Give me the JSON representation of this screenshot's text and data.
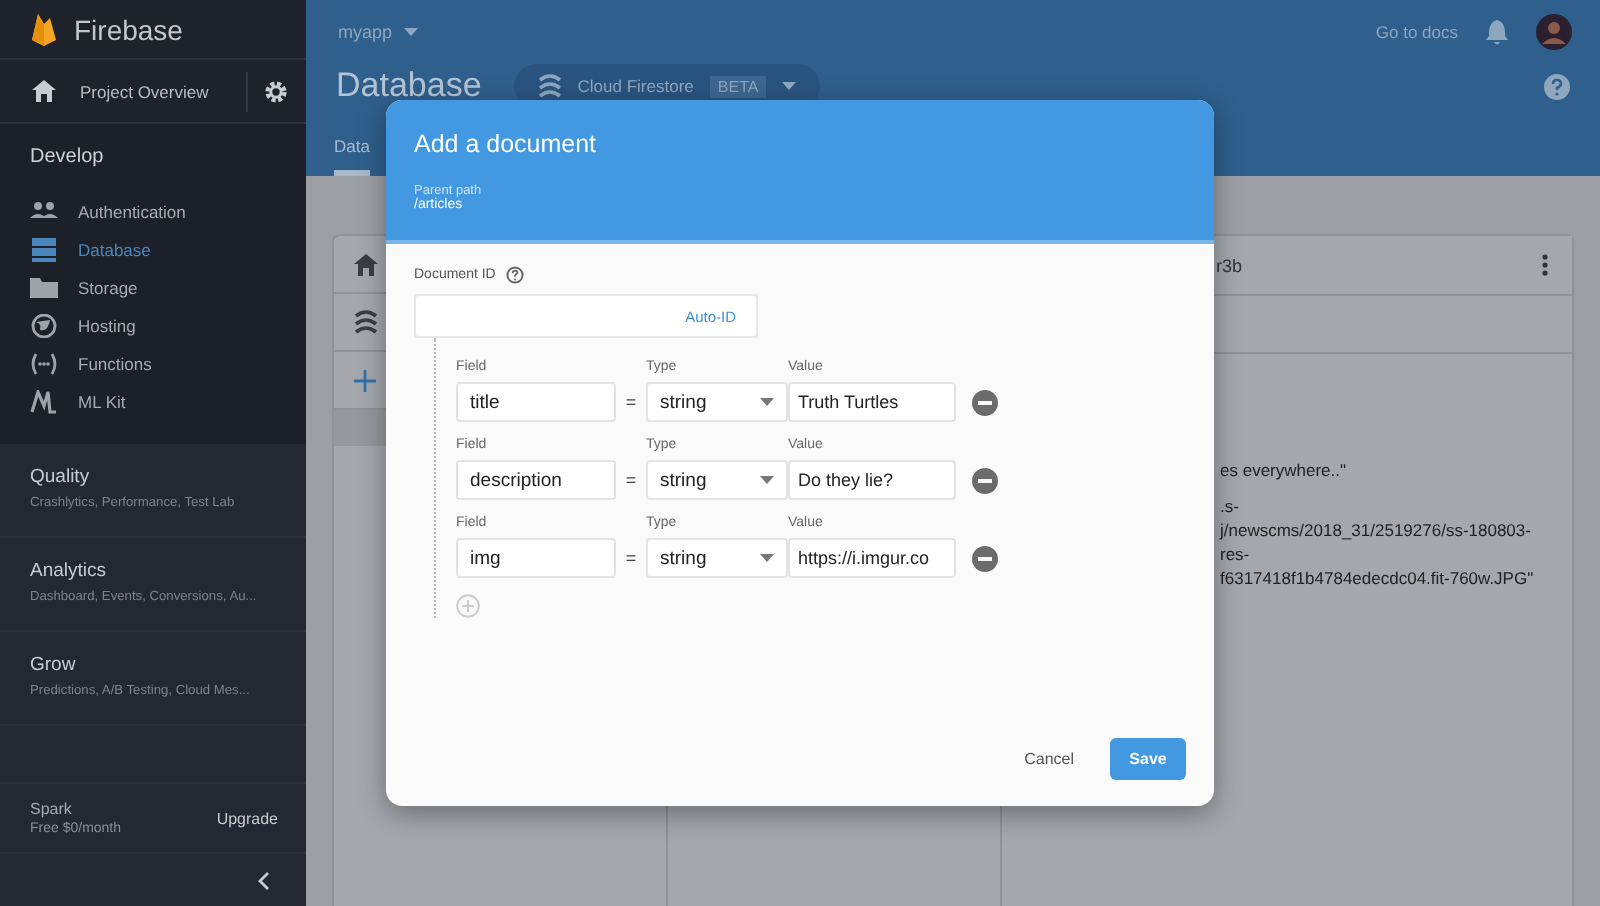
{
  "sidebar": {
    "brand": "Firebase",
    "project_overview": "Project Overview",
    "develop": {
      "title": "Develop",
      "items": [
        {
          "label": "Authentication",
          "kind": "people",
          "selected": false
        },
        {
          "label": "Database",
          "kind": "database",
          "selected": true
        },
        {
          "label": "Storage",
          "kind": "storage",
          "selected": false
        },
        {
          "label": "Hosting",
          "kind": "globe",
          "selected": false
        },
        {
          "label": "Functions",
          "kind": "functions",
          "selected": false
        },
        {
          "label": "ML Kit",
          "kind": "mlkit",
          "selected": false
        }
      ]
    },
    "categories": [
      {
        "title": "Quality",
        "subtitle": "Crashlytics, Performance, Test Lab"
      },
      {
        "title": "Analytics",
        "subtitle": "Dashboard, Events, Conversions, Au..."
      },
      {
        "title": "Grow",
        "subtitle": "Predictions, A/B Testing, Cloud Mes..."
      }
    ],
    "plan": {
      "name": "Spark",
      "price": "Free $0/month",
      "action": "Upgrade"
    }
  },
  "header": {
    "project": "myapp",
    "docs_link": "Go to docs",
    "title": "Database",
    "db_selector": {
      "label": "Cloud Firestore",
      "badge": "BETA"
    },
    "tabs": [
      {
        "label": "Data",
        "selected": true
      }
    ]
  },
  "panel": {
    "document_id": "r3b",
    "lines": [
      "es everywhere..\"",
      ".s-",
      "j/newscms/2018_31/2519276/ss-180803-",
      "res-",
      "f6317418f1b4784edecdc04.fit-760w.JPG\""
    ]
  },
  "dialog": {
    "title": "Add a document",
    "parent_label": "Parent path",
    "parent_path": "/articles",
    "doc_id_label": "Document ID",
    "auto_id": "Auto-ID",
    "rows": [
      {
        "field_label": "Field",
        "type_label": "Type",
        "value_label": "Value",
        "field": "title",
        "equals": "=",
        "type": "string",
        "value": "Truth Turtles"
      },
      {
        "field_label": "Field",
        "type_label": "Type",
        "value_label": "Value",
        "field": "description",
        "equals": "=",
        "type": "string",
        "value": "Do they lie?"
      },
      {
        "field_label": "Field",
        "type_label": "Type",
        "value_label": "Value",
        "field": "img",
        "equals": "=",
        "type": "string",
        "value": "https://i.imgur.co"
      }
    ],
    "cancel": "Cancel",
    "save": "Save"
  }
}
